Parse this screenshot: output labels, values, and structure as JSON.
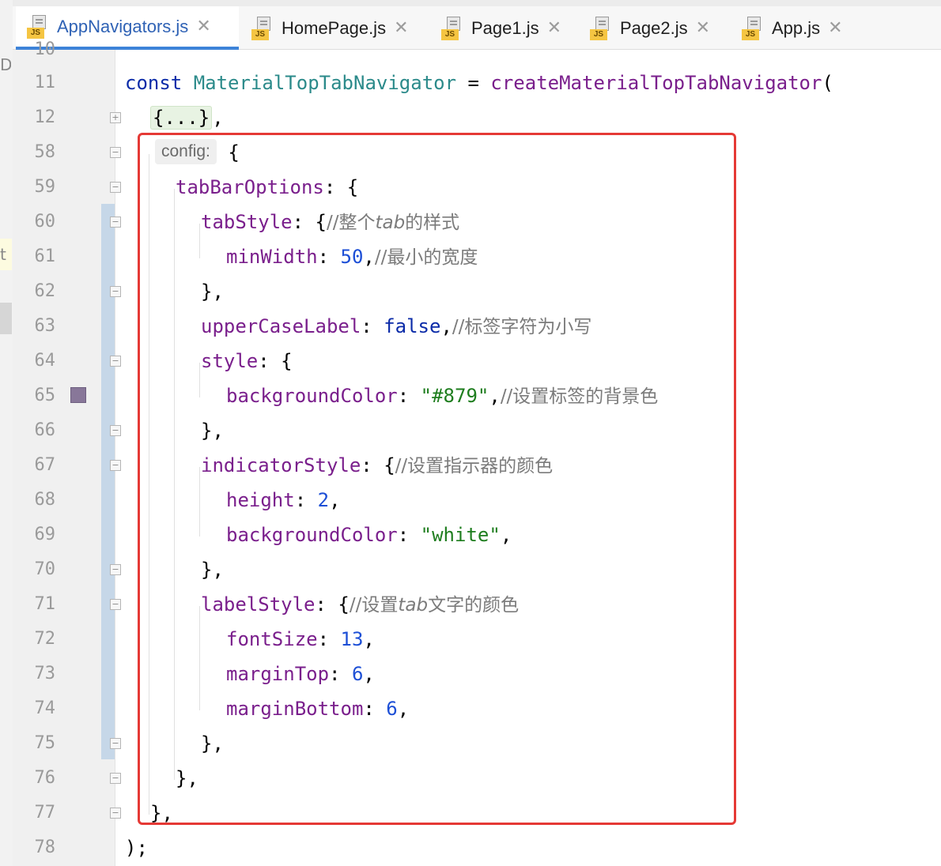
{
  "tabs": [
    {
      "label": "AppNavigators.js",
      "active": true,
      "icon": "js-file-icon"
    },
    {
      "label": "HomePage.js",
      "active": false,
      "icon": "js-file-icon"
    },
    {
      "label": "Page1.js",
      "active": false,
      "icon": "js-file-icon"
    },
    {
      "label": "Page2.js",
      "active": false,
      "icon": "js-file-icon"
    },
    {
      "label": "App.js",
      "active": false,
      "icon": "js-file-icon"
    }
  ],
  "js_badge": "JS",
  "close_glyph": "✕",
  "left_strip_fragments": [
    "D",
    "t"
  ],
  "line_numbers": [
    "10",
    "11",
    "12",
    "58",
    "59",
    "60",
    "61",
    "62",
    "63",
    "64",
    "65",
    "66",
    "67",
    "68",
    "69",
    "70",
    "71",
    "72",
    "73",
    "74",
    "75",
    "76",
    "77",
    "78"
  ],
  "colors": {
    "accent": "#3d83d8",
    "highlight_box": "#e53935",
    "swatch_879": "#887799",
    "change_bar": "#c6d7e8"
  },
  "code": {
    "l11": {
      "kw": "const",
      "name": "MaterialTopTabNavigator",
      "op": " = ",
      "fn": "createMaterialTopTabNavigator",
      "paren": "("
    },
    "l12": {
      "folded": "{...}",
      "tail": ","
    },
    "l58": {
      "hint": "config:",
      "brace": " {"
    },
    "l59": {
      "prop": "tabBarOptions",
      "rest": ": {"
    },
    "l60": {
      "prop": "tabStyle",
      "rest": ": {",
      "c1": "//整个",
      "c2": "tab",
      "c3": "的样式"
    },
    "l61": {
      "prop": "minWidth",
      "colon": ": ",
      "num": "50",
      "tail": ",",
      "c1": "//最小的宽度"
    },
    "l62": {
      "text": "},"
    },
    "l63": {
      "prop": "upperCaseLabel",
      "colon": ": ",
      "bool": "false",
      "tail": ",",
      "c1": "//标签字符为小写"
    },
    "l64": {
      "prop": "style",
      "rest": ": {"
    },
    "l65": {
      "prop": "backgroundColor",
      "colon": ": ",
      "str": "\"#879\"",
      "tail": ",",
      "c1": "//设置标签的背景色"
    },
    "l66": {
      "text": "},"
    },
    "l67": {
      "prop": "indicatorStyle",
      "rest": ": {",
      "c1": "//设置指示器的颜色"
    },
    "l68": {
      "prop": "height",
      "colon": ": ",
      "num": "2",
      "tail": ","
    },
    "l69": {
      "prop": "backgroundColor",
      "colon": ": ",
      "str": "\"white\"",
      "tail": ","
    },
    "l70": {
      "text": "},"
    },
    "l71": {
      "prop": "labelStyle",
      "rest": ": {",
      "c1": "//设置",
      "c2": "tab",
      "c3": "文字的颜色"
    },
    "l72": {
      "prop": "fontSize",
      "colon": ": ",
      "num": "13",
      "tail": ","
    },
    "l73": {
      "prop": "marginTop",
      "colon": ": ",
      "num": "6",
      "tail": ","
    },
    "l74": {
      "prop": "marginBottom",
      "colon": ": ",
      "num": "6",
      "tail": ","
    },
    "l75": {
      "text": "},"
    },
    "l76": {
      "text": "},"
    },
    "l77": {
      "text": "},"
    },
    "l78": {
      "text": ");"
    }
  }
}
